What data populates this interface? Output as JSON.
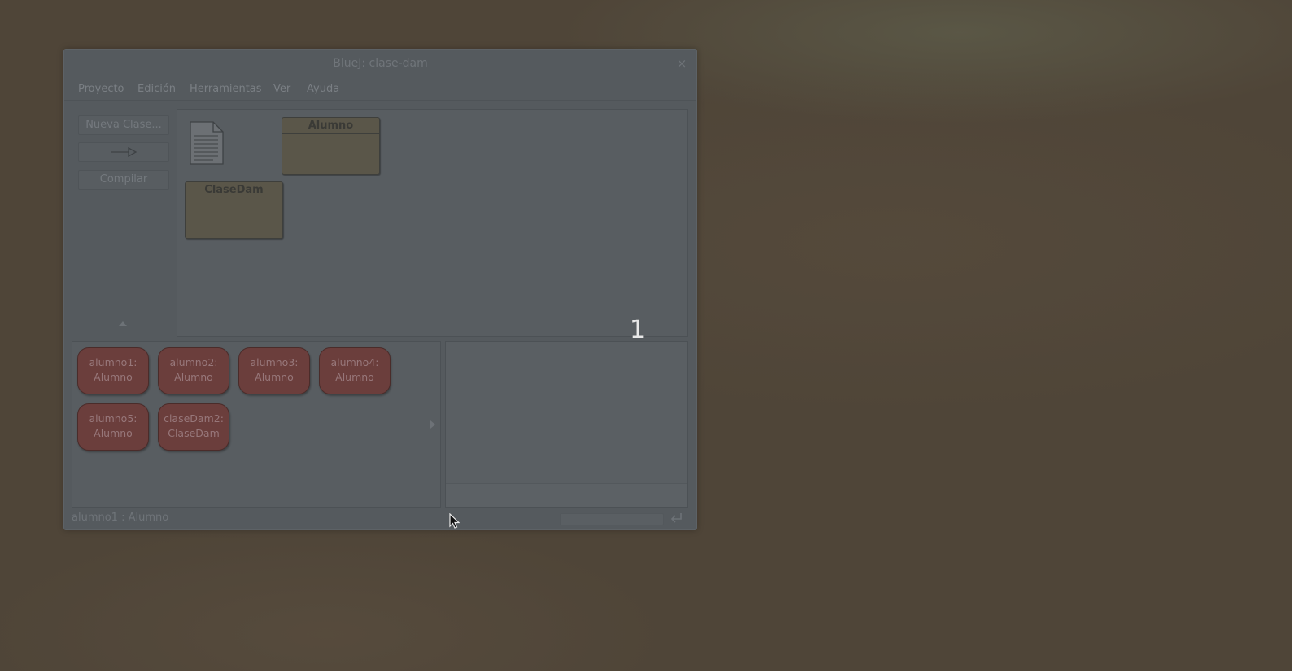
{
  "window": {
    "title": "BlueJ: clase-dam",
    "close_glyph": "×"
  },
  "menu": [
    "Proyecto",
    "Edición",
    "Herramientas",
    "Ver",
    "Ayuda"
  ],
  "toolbar": {
    "new_class_label": "Nueva Clase...",
    "arrow_icon": "inheritance-arrow-icon",
    "compile_label": "Compilar"
  },
  "classes": [
    {
      "name": "Alumno"
    },
    {
      "name": "ClaseDam"
    }
  ],
  "objects": [
    {
      "line1": "alumno1:",
      "line2": "Alumno"
    },
    {
      "line1": "alumno2:",
      "line2": "Alumno"
    },
    {
      "line1": "alumno3:",
      "line2": "Alumno"
    },
    {
      "line1": "alumno4:",
      "line2": "Alumno"
    },
    {
      "line1": "alumno5:",
      "line2": "Alumno"
    },
    {
      "line1": "claseDam2:",
      "line2": "ClaseDam"
    }
  ],
  "overlay_number": "1",
  "status_text": "alumno1 : Alumno",
  "colors": {
    "desktop": "#4f4538",
    "window": "#555a5e",
    "class_box": "#5a5649",
    "object": "#6b3e3c"
  }
}
